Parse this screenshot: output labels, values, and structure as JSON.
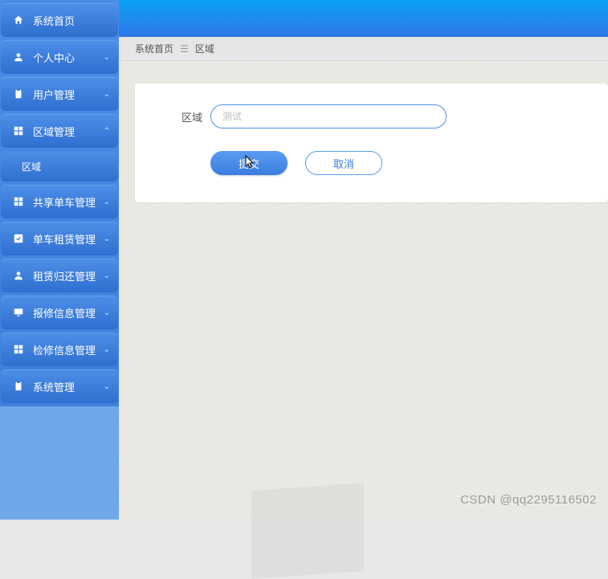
{
  "sidebar": {
    "items": [
      {
        "label": "系统首页",
        "icon": "home-icon",
        "expandable": false
      },
      {
        "label": "个人中心",
        "icon": "person-icon",
        "expandable": true
      },
      {
        "label": "用户管理",
        "icon": "clipboard-icon",
        "expandable": true
      },
      {
        "label": "区域管理",
        "icon": "grid-icon",
        "expandable": true,
        "expanded": true
      },
      {
        "label": "共享单车管理",
        "icon": "grid-icon",
        "expandable": true
      },
      {
        "label": "单车租赁管理",
        "icon": "check-icon",
        "expandable": true
      },
      {
        "label": "租赁归还管理",
        "icon": "person-icon",
        "expandable": true
      },
      {
        "label": "报修信息管理",
        "icon": "monitor-icon",
        "expandable": true
      },
      {
        "label": "检修信息管理",
        "icon": "grid-icon",
        "expandable": true
      },
      {
        "label": "系统管理",
        "icon": "clipboard-icon",
        "expandable": true
      }
    ],
    "sub_item": {
      "label": "区域"
    }
  },
  "breadcrumb": {
    "home": "系统首页",
    "current": "区域"
  },
  "form": {
    "region_label": "区域",
    "region_placeholder": "测试",
    "region_value": "",
    "submit_label": "提交",
    "cancel_label": "取消"
  },
  "watermark": "CSDN @qq2295116502",
  "colors": {
    "primary": "#3a7de0",
    "sidebar_bg": "#4d8fe8"
  }
}
